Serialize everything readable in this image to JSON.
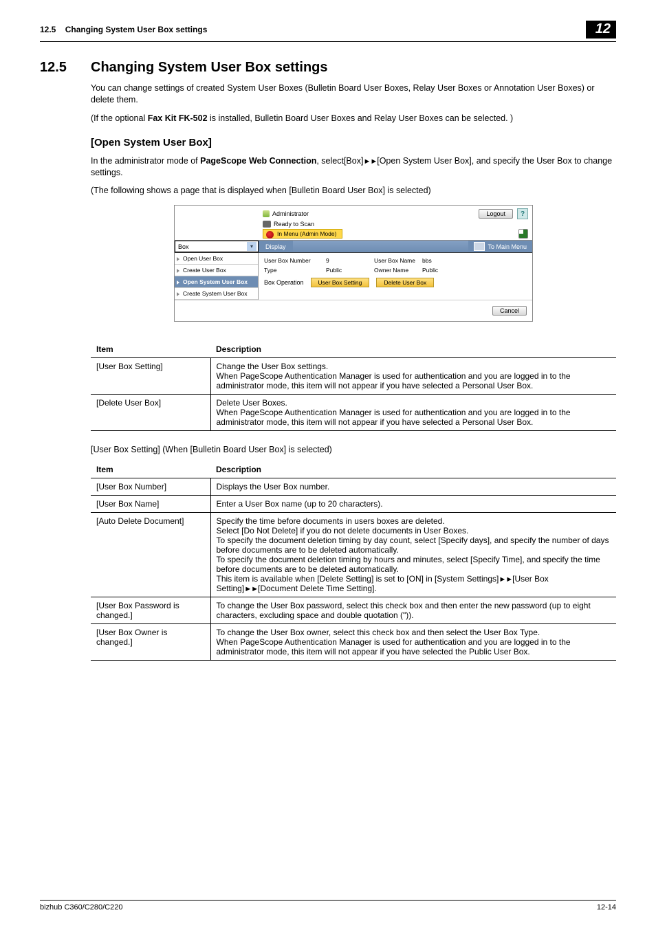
{
  "header": {
    "section_ref": "12.5",
    "section_name": "Changing System User Box settings",
    "chapter_badge": "12"
  },
  "section": {
    "number": "12.5",
    "title": "Changing System User Box settings"
  },
  "intro": {
    "p1": "You can change settings of created System User Boxes (Bulletin Board User Boxes, Relay User Boxes or Annotation User Boxes) or delete them.",
    "p2_pre": "(If the optional ",
    "p2_bold": "Fax Kit FK-502",
    "p2_post": " is installed, Bulletin Board User Boxes and Relay User Boxes can be selected. )"
  },
  "open_box": {
    "heading": "[Open System User Box]",
    "p1_pre": "In the administrator mode of ",
    "p1_bold": "PageScope Web Connection",
    "p1_mid": ", select[Box]",
    "p1_arrows": "►►",
    "p1_post": "[Open System User Box], and specify the User Box to change settings.",
    "p2": "(The following shows a page that is displayed when [Bulletin Board User Box] is selected)"
  },
  "screenshot": {
    "administrator": "Administrator",
    "logout": "Logout",
    "help": "?",
    "ready": "Ready to Scan",
    "mode": "In Menu (Admin Mode)",
    "select_value": "Box",
    "display_btn": "Display",
    "to_main": "To Main Menu",
    "nav": {
      "open_user_box": "Open User Box",
      "create_user_box": "Create User Box",
      "open_system_user_box": "Open System User Box",
      "create_system_user_box": "Create System User Box"
    },
    "fields": {
      "ubn_label": "User Box Number",
      "ubn_value": "9",
      "ubname_label": "User Box Name",
      "ubname_value": "bbs",
      "type_label": "Type",
      "type_value": "Public",
      "owner_label": "Owner Name",
      "owner_value": "Public",
      "box_op_label": "Box Operation"
    },
    "buttons": {
      "user_box_setting": "User Box Setting",
      "delete_user_box": "Delete User Box",
      "cancel": "Cancel"
    }
  },
  "table1": {
    "h_item": "Item",
    "h_desc": "Description",
    "rows": [
      {
        "item": "[User Box Setting]",
        "desc_pre": "Change the User Box settings.\nWhen ",
        "desc_bold": "PageScope Authentication Manager",
        "desc_post": " is used for authentication and you are logged in to the administrator mode, this item will not appear if you have selected a Personal User Box."
      },
      {
        "item": "[Delete User Box]",
        "desc_pre": "Delete User Boxes.\nWhen ",
        "desc_bold": "PageScope Authentication Manager",
        "desc_post": " is used for authentication and you are logged in to the administrator mode, this item will not appear if you have selected a Personal User Box."
      }
    ]
  },
  "caption2": "[User Box Setting] (When [Bulletin Board User Box] is selected)",
  "table2": {
    "h_item": "Item",
    "h_desc": "Description",
    "rows": [
      {
        "item": "[User Box Number]",
        "desc": "Displays the User Box number."
      },
      {
        "item": "[User Box Name]",
        "desc": "Enter a User Box name (up to 20 characters)."
      },
      {
        "item": "[Auto Delete Document]",
        "desc_a": "Specify the time before documents in users boxes are deleted.\nSelect [Do Not Delete] if you do not delete documents in User Boxes.\nTo specify the document deletion timing by day count, select [Specify days], and specify the number of days before documents are to be deleted automatically.\nTo specify the document deletion timing by hours and minutes, select [Specify Time], and specify the time before documents are to be deleted automatically.\nThis item is available when [Delete Setting] is set to [ON] in [System Settings]",
        "arr1": "►►",
        "desc_b": "[User Box Setting]",
        "arr2": "►►",
        "desc_c": "[Document Delete Time Setting]."
      },
      {
        "item": "[User Box Password is changed.]",
        "desc": "To change the User Box password, select this check box and then enter the new password (up to eight characters, excluding space and double quotation (\"))."
      },
      {
        "item": "[User Box Owner is changed.]",
        "desc_pre": "To change the User Box owner, select this check box and then select the User Box Type.\nWhen ",
        "desc_bold": "PageScope Authentication Manager",
        "desc_post": " is used for authentication and you are logged in to the administrator mode, this item will not appear if you have selected the Public User Box."
      }
    ]
  },
  "footer": {
    "left": "bizhub C360/C280/C220",
    "right": "12-14"
  }
}
